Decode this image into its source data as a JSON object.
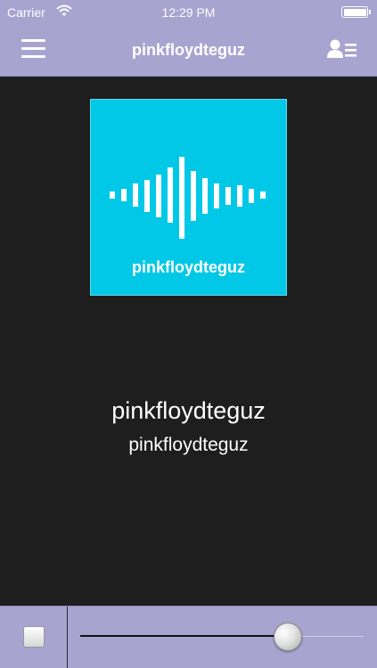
{
  "status_bar": {
    "carrier": "Carrier",
    "time": "12:29 PM"
  },
  "nav": {
    "title": "pinkfloydteguz",
    "menu_icon": "hamburger-menu-icon",
    "right_icon": "contacts-list-icon"
  },
  "artwork": {
    "label": "pinkfloydteguz",
    "background": "#00c8e6",
    "icon": "sound-wave-icon"
  },
  "now_playing": {
    "title": "pinkfloydteguz",
    "subtitle": "pinkfloydteguz"
  },
  "player": {
    "stop_icon": "stop-icon",
    "volume_level": 0.73
  },
  "colors": {
    "bar": "#a9a3d0",
    "background": "#1e1e1e",
    "accent": "#00c8e6"
  }
}
